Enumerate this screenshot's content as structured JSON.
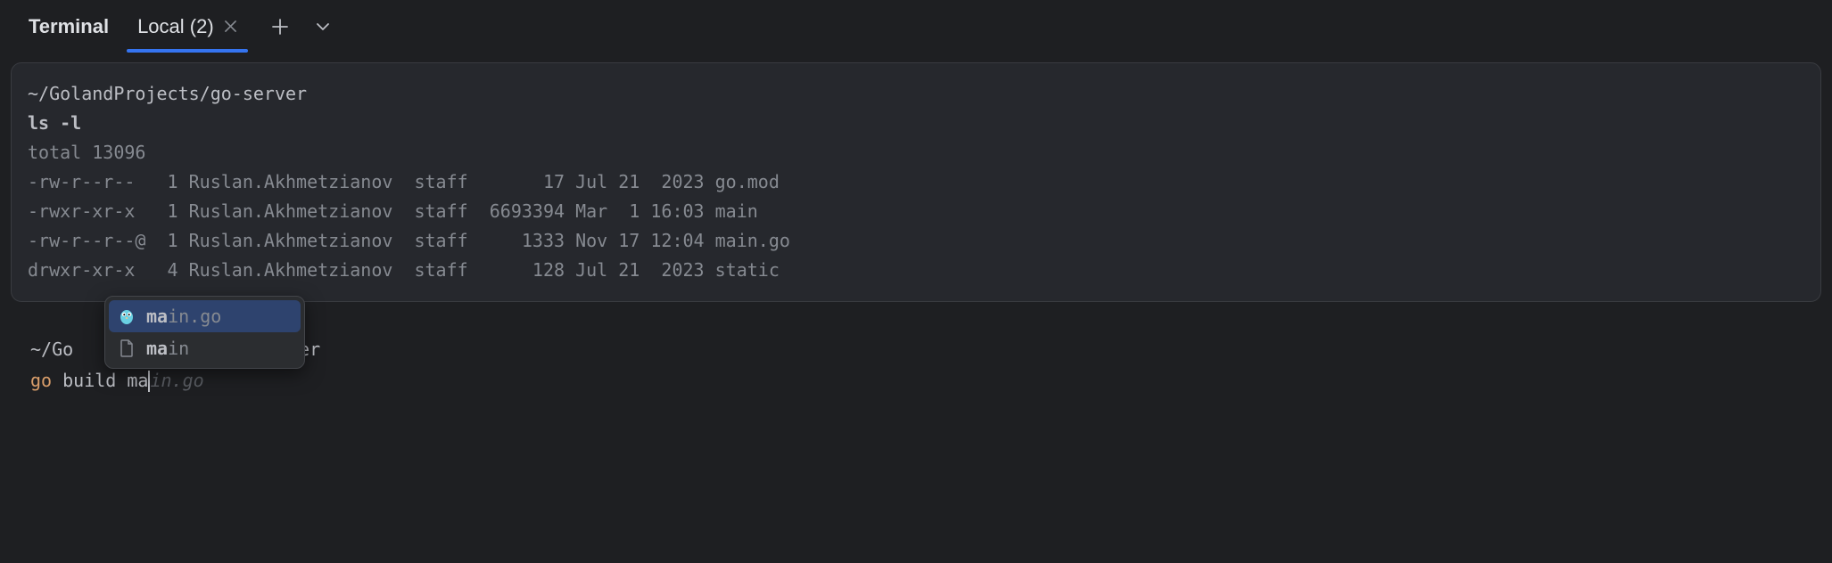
{
  "tabBar": {
    "title": "Terminal",
    "activeTab": "Local (2)"
  },
  "terminalFrame": {
    "path": "~/GolandProjects/go-server",
    "command": "ls -l",
    "output": [
      "total 13096",
      "-rw-r--r--   1 Ruslan.Akhmetzianov  staff       17 Jul 21  2023 go.mod",
      "-rwxr-xr-x   1 Ruslan.Akhmetzianov  staff  6693394 Mar  1 16:03 main",
      "-rw-r--r--@  1 Ruslan.Akhmetzianov  staff     1333 Nov 17 12:04 main.go",
      "drwxr-xr-x   4 Ruslan.Akhmetzianov  staff      128 Jul 21  2023 static"
    ]
  },
  "promptArea": {
    "pathPrefix": "~/Go",
    "pathSuffix": "rver",
    "cmdGo": "go",
    "cmdTyped": " build ma",
    "cmdSuggest": "in.go"
  },
  "autocomplete": {
    "items": [
      {
        "icon": "go-gopher",
        "match": "ma",
        "rest": "in.go",
        "selected": true
      },
      {
        "icon": "file",
        "match": "ma",
        "rest": "in",
        "selected": false
      }
    ]
  }
}
